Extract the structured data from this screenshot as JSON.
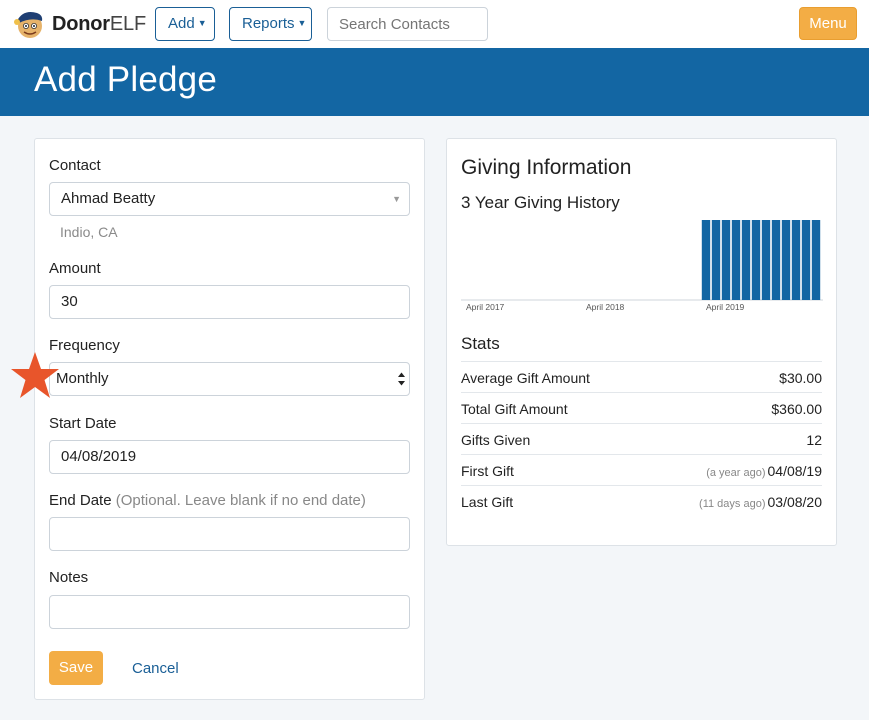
{
  "navbar": {
    "brand_bold": "Donor",
    "brand_light": "ELF",
    "add_label": "Add",
    "reports_label": "Reports",
    "search_placeholder": "Search Contacts",
    "menu_label": "Menu"
  },
  "page_title": "Add Pledge",
  "form": {
    "contact_label": "Contact",
    "contact_value": "Ahmad Beatty",
    "contact_location": "Indio, CA",
    "amount_label": "Amount",
    "amount_value": "30",
    "frequency_label": "Frequency",
    "frequency_value": "Monthly",
    "start_date_label": "Start Date",
    "start_date_value": "04/08/2019",
    "end_date_label": "End Date",
    "end_date_hint": "(Optional. Leave blank if no end date)",
    "end_date_value": "",
    "notes_label": "Notes",
    "notes_value": "",
    "save_label": "Save",
    "cancel_label": "Cancel"
  },
  "giving": {
    "title": "Giving Information",
    "history_title": "3 Year Giving History",
    "stats_title": "Stats",
    "stats": [
      {
        "label": "Average Gift Amount",
        "ago": "",
        "value": "$30.00"
      },
      {
        "label": "Total Gift Amount",
        "ago": "",
        "value": "$360.00"
      },
      {
        "label": "Gifts Given",
        "ago": "",
        "value": "12"
      },
      {
        "label": "First Gift",
        "ago": "(a year ago)",
        "value": "04/08/19"
      },
      {
        "label": "Last Gift",
        "ago": "(11 days ago)",
        "value": "03/08/20"
      }
    ]
  },
  "chart_data": {
    "type": "bar",
    "title": "3 Year Giving History",
    "x_tick_labels": [
      "April 2017",
      "April 2018",
      "April 2019"
    ],
    "categories": [
      "Apr 2017",
      "May 2017",
      "Jun 2017",
      "Jul 2017",
      "Aug 2017",
      "Sep 2017",
      "Oct 2017",
      "Nov 2017",
      "Dec 2017",
      "Jan 2018",
      "Feb 2018",
      "Mar 2018",
      "Apr 2018",
      "May 2018",
      "Jun 2018",
      "Jul 2018",
      "Aug 2018",
      "Sep 2018",
      "Oct 2018",
      "Nov 2018",
      "Dec 2018",
      "Jan 2019",
      "Feb 2019",
      "Mar 2019",
      "Apr 2019",
      "May 2019",
      "Jun 2019",
      "Jul 2019",
      "Aug 2019",
      "Sep 2019",
      "Oct 2019",
      "Nov 2019",
      "Dec 2019",
      "Jan 2020",
      "Feb 2020",
      "Mar 2020"
    ],
    "values": [
      0,
      0,
      0,
      0,
      0,
      0,
      0,
      0,
      0,
      0,
      0,
      0,
      0,
      0,
      0,
      0,
      0,
      0,
      0,
      0,
      0,
      0,
      0,
      0,
      30,
      30,
      30,
      30,
      30,
      30,
      30,
      30,
      30,
      30,
      30,
      30
    ],
    "ylim": [
      0,
      30
    ],
    "bar_color": "#1366a3",
    "grid": false
  },
  "colors": {
    "brand_blue": "#1366a3",
    "accent_orange": "#f3ad45",
    "star_orange": "#e8552b"
  },
  "icons": {
    "logo": "elf-logo-icon",
    "add_caret": "chevron-down-icon",
    "frequency_arrows": "select-updown-icon",
    "annotation": "star-icon"
  }
}
